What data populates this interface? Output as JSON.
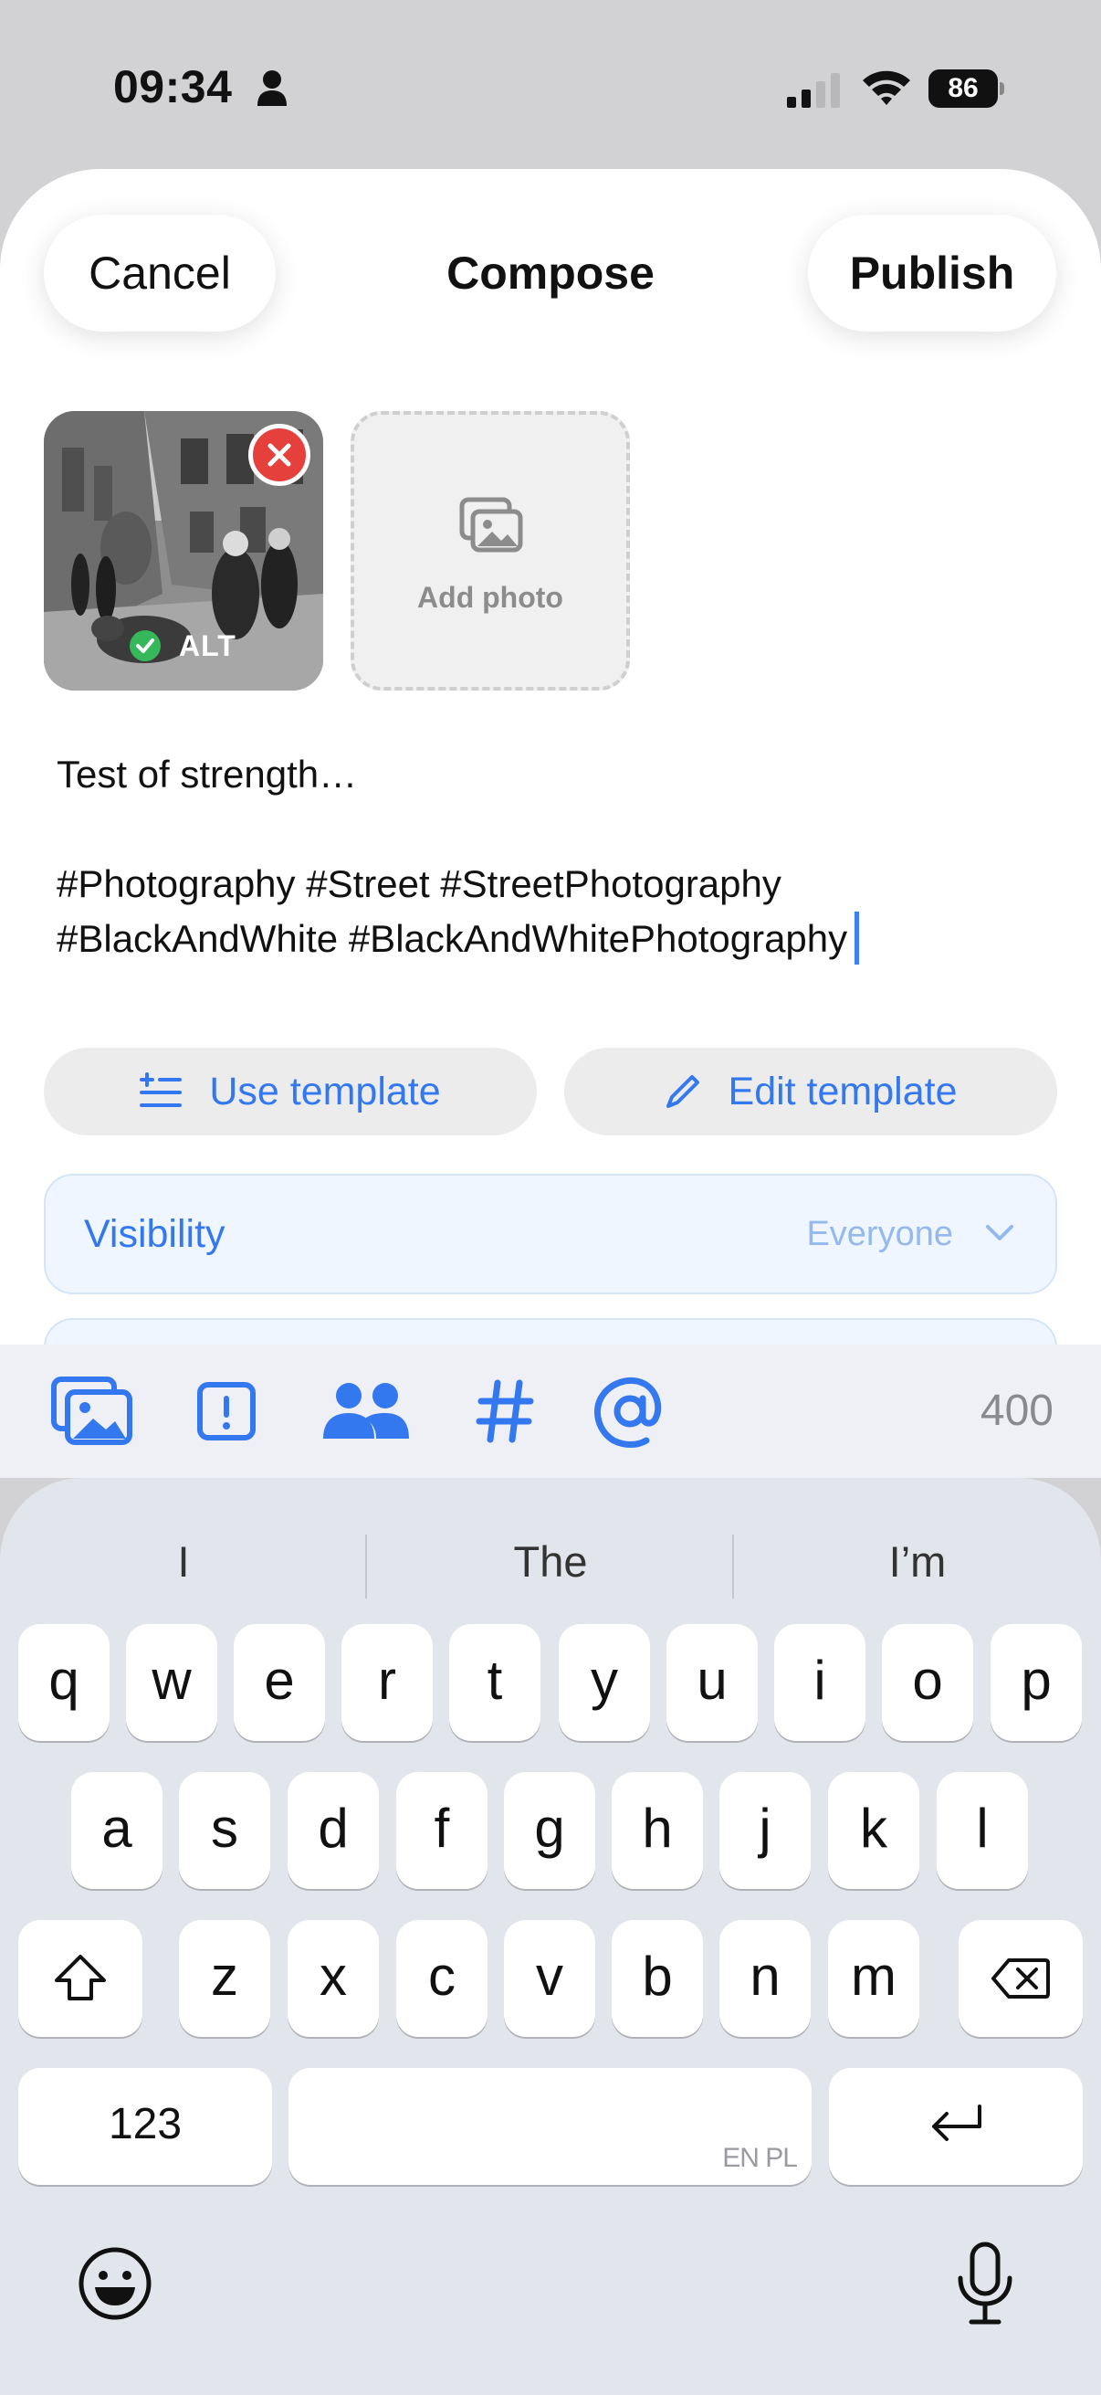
{
  "status_bar": {
    "time": "09:34",
    "battery": "86"
  },
  "header": {
    "cancel_label": "Cancel",
    "title": "Compose",
    "publish_label": "Publish"
  },
  "attachments": {
    "alt_label": "ALT",
    "add_photo_label": "Add photo"
  },
  "post": {
    "lines": [
      "Test of strength…",
      "",
      "#Photography #Street #StreetPhotography",
      "#BlackAndWhite #BlackAndWhitePhotography"
    ]
  },
  "templates": {
    "use_label": "Use template",
    "edit_label": "Edit template"
  },
  "visibility": {
    "label": "Visibility",
    "value": "Everyone"
  },
  "toolbar": {
    "char_count": "400",
    "icons": [
      "image-icon",
      "content-warning-icon",
      "people-icon",
      "hashtag-icon",
      "mention-icon"
    ]
  },
  "keyboard": {
    "suggestions": [
      "I",
      "The",
      "I’m"
    ],
    "row1": [
      "q",
      "w",
      "e",
      "r",
      "t",
      "y",
      "u",
      "i",
      "o",
      "p"
    ],
    "row2": [
      "a",
      "s",
      "d",
      "f",
      "g",
      "h",
      "j",
      "k",
      "l"
    ],
    "row3": [
      "z",
      "x",
      "c",
      "v",
      "b",
      "n",
      "m"
    ],
    "numbers_label": "123",
    "space_hint": "EN PL"
  },
  "colors": {
    "accent": "#3478f0",
    "danger": "#e5403b",
    "success": "#35b85a"
  }
}
